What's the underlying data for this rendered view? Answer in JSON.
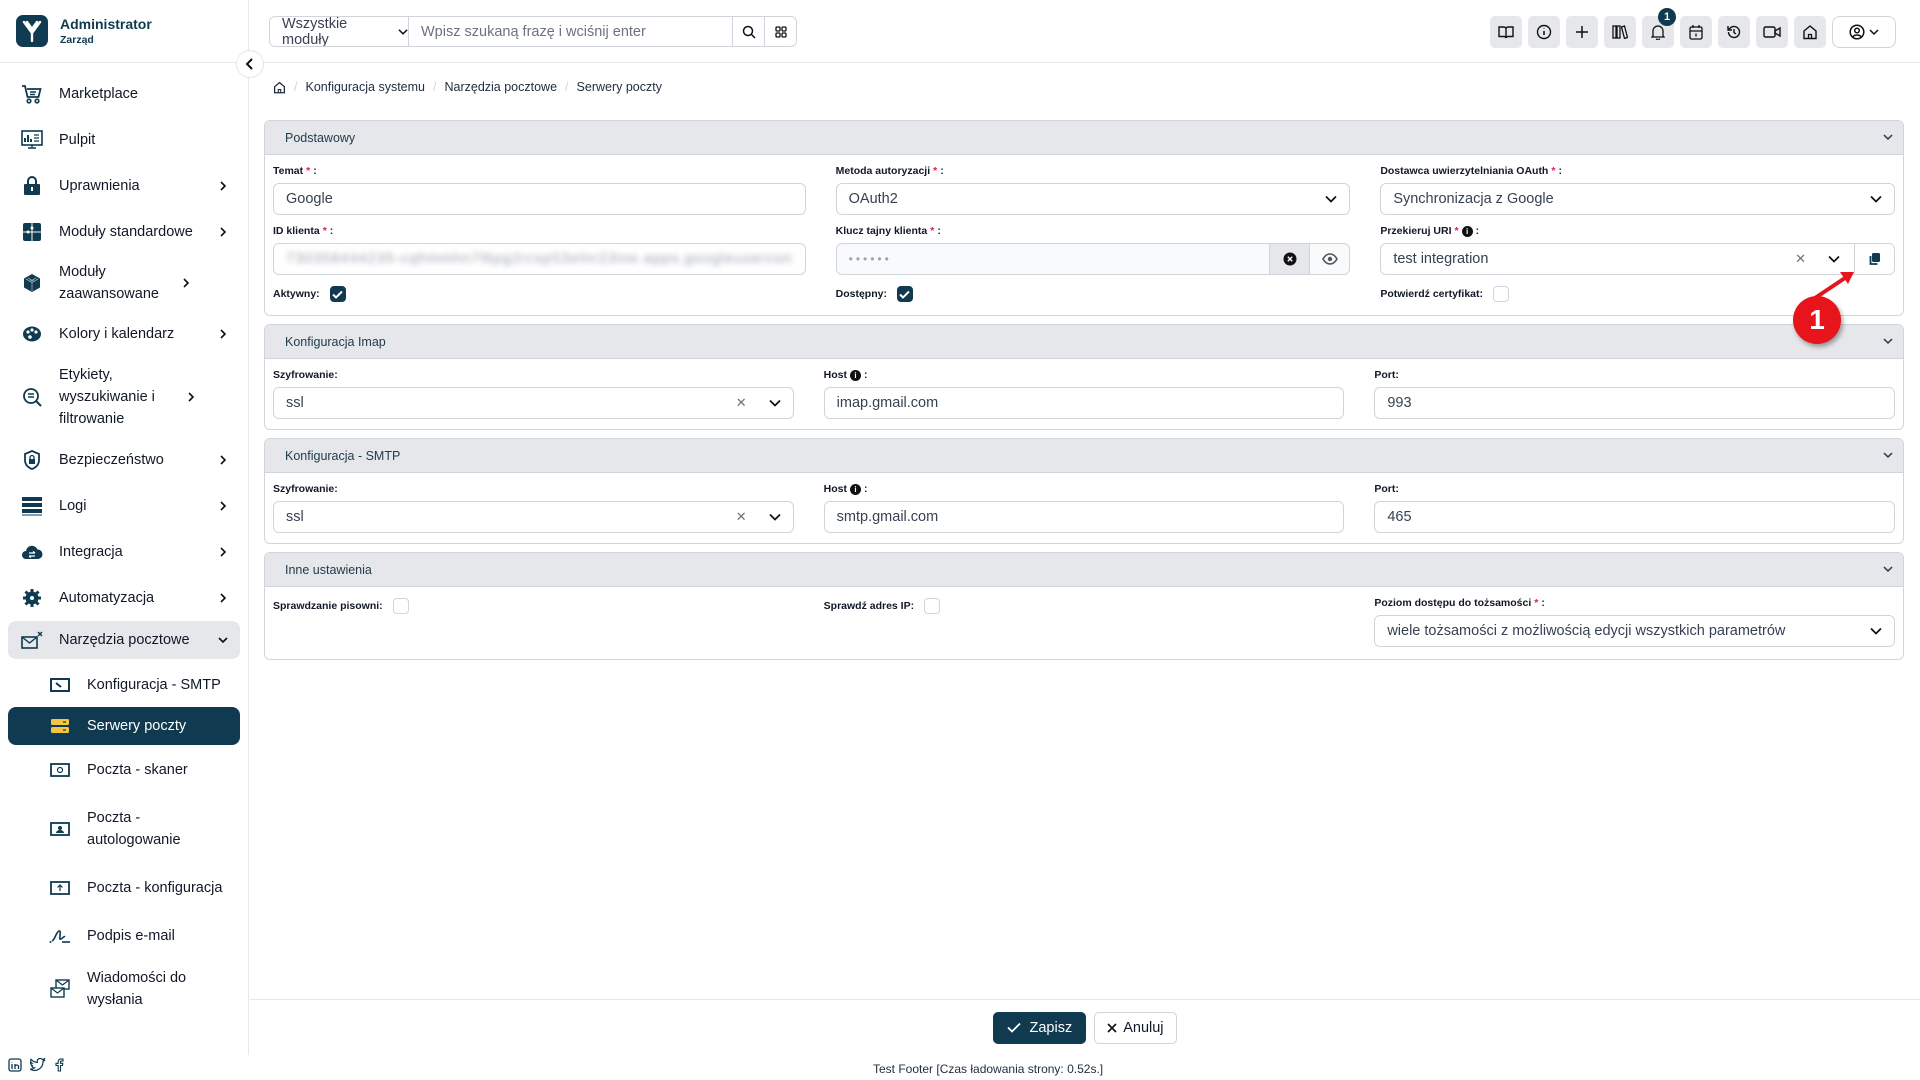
{
  "brand": {
    "title": "Administrator",
    "subtitle": "Zarząd"
  },
  "sidebar": {
    "items": [
      {
        "label": "Marketplace",
        "icon": "cart-icon",
        "has_children": false
      },
      {
        "label": "Pulpit",
        "icon": "dashboard-icon",
        "has_children": false
      },
      {
        "label": "Uprawnienia",
        "icon": "lock-icon",
        "has_children": true
      },
      {
        "label": "Moduły standardowe",
        "icon": "puzzle-icon",
        "has_children": true
      },
      {
        "label": "Moduły zaawansowane",
        "icon": "cube-icon",
        "has_children": true
      },
      {
        "label": "Kolory i kalendarz",
        "icon": "palette-icon",
        "has_children": true
      },
      {
        "label": "Etykiety, wyszukiwanie i filtrowanie",
        "icon": "search-list-icon",
        "has_children": true
      },
      {
        "label": "Bezpieczeństwo",
        "icon": "shield-icon",
        "has_children": true
      },
      {
        "label": "Logi",
        "icon": "server-icon",
        "has_children": true
      },
      {
        "label": "Integracja",
        "icon": "cloud-icon",
        "has_children": true
      },
      {
        "label": "Automatyzacja",
        "icon": "gear-icon",
        "has_children": true
      },
      {
        "label": "Narzędzia pocztowe",
        "icon": "mail-tools-icon",
        "has_children": true,
        "expanded": true
      }
    ],
    "subitems": [
      {
        "label": "Konfiguracja - SMTP",
        "icon": "smtp-icon"
      },
      {
        "label": "Serwery poczty",
        "icon": "mail-server-icon",
        "active": true
      },
      {
        "label": "Poczta - skaner",
        "icon": "scanner-icon"
      },
      {
        "label": "Poczta - autologowanie",
        "icon": "autologin-icon"
      },
      {
        "label": "Poczta - konfiguracja",
        "icon": "mail-config-icon"
      },
      {
        "label": "Podpis e-mail",
        "icon": "signature-icon"
      },
      {
        "label": "Wiadomości do wysłania",
        "icon": "outbox-icon"
      }
    ],
    "social": [
      "linkedin-icon",
      "twitter-icon",
      "facebook-icon"
    ]
  },
  "topbar": {
    "module_select": "Wszystkie moduły",
    "search_placeholder": "Wpisz szukaną frazę i wciśnij enter",
    "icons": [
      "book-icon",
      "info-icon",
      "plus-icon",
      "library-icon",
      "bell-icon",
      "calendar-icon",
      "history-icon",
      "video-icon",
      "home-icon"
    ],
    "notification_count": "1"
  },
  "breadcrumb": [
    "Konfiguracja systemu",
    "Narzędzia pocztowe",
    "Serwery poczty"
  ],
  "sections": {
    "basic": {
      "title": "Podstawowy",
      "temat_label": "Temat",
      "temat_value": "Google",
      "metoda_label": "Metoda autoryzacji",
      "metoda_value": "OAuth2",
      "dostawca_label": "Dostawca uwierzytelniania OAuth",
      "dostawca_value": "Synchronizacja z Google",
      "id_label": "ID klienta",
      "id_value": "730358444235-cqhmmhn7l6pg2rcsp53elnr23ine.apps.googleusercon",
      "klucz_label": "Klucz tajny klienta",
      "klucz_value": "••••••",
      "uri_label": "Przekieruj URI",
      "uri_value": "test integration",
      "aktywny_label": "Aktywny:",
      "aktywny_checked": true,
      "dostepny_label": "Dostępny:",
      "dostepny_checked": true,
      "cert_label": "Potwierdź certyfikat:",
      "cert_checked": false
    },
    "imap": {
      "title": "Konfiguracja Imap",
      "enc_label": "Szyfrowanie:",
      "enc_value": "ssl",
      "host_label": "Host",
      "host_value": "imap.gmail.com",
      "port_label": "Port:",
      "port_value": "993"
    },
    "smtp": {
      "title": "Konfiguracja - SMTP",
      "enc_label": "Szyfrowanie:",
      "enc_value": "ssl",
      "host_label": "Host",
      "host_value": "smtp.gmail.com",
      "port_label": "Port:",
      "port_value": "465"
    },
    "other": {
      "title": "Inne ustawienia",
      "spell_label": "Sprawdzanie pisowni:",
      "spell_checked": false,
      "ip_label": "Sprawdź adres IP:",
      "ip_checked": false,
      "access_label": "Poziom dostępu do tożsamości",
      "access_value": "wiele tożsamości z możliwością edycji wszystkich parametrów"
    }
  },
  "actions": {
    "save": "Zapisz",
    "cancel": "Anuluj"
  },
  "footer": "Test Footer [Czas ładowania strony: 0.52s.]",
  "annotation": {
    "number": "1"
  },
  "colors": {
    "primary": "#0f3a4f",
    "required": "#e11d48",
    "annotation": "#e8141b"
  }
}
